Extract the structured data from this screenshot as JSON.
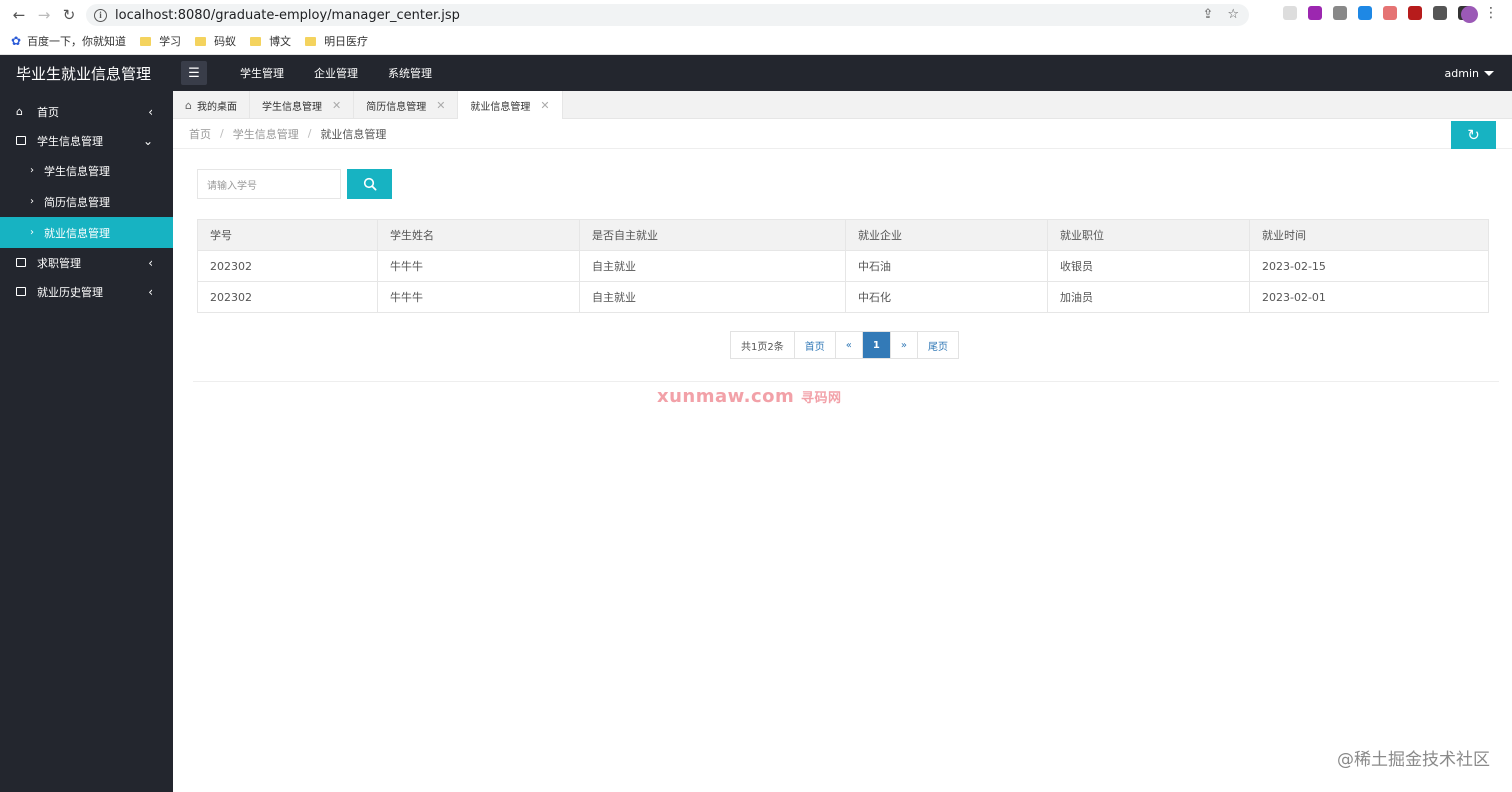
{
  "browser": {
    "url": "localhost:8080/graduate-employ/manager_center.jsp",
    "bookmarks": [
      "百度一下，你就知道",
      "学习",
      "码蚁",
      "博文",
      "明日医疗"
    ]
  },
  "app": {
    "title": "毕业生就业信息管理",
    "topnav": [
      "学生管理",
      "企业管理",
      "系统管理"
    ],
    "user": "admin"
  },
  "sidebar": {
    "home": "首页",
    "student_group": "学生信息管理",
    "sub_items": [
      "学生信息管理",
      "简历信息管理",
      "就业信息管理"
    ],
    "job_manage": "求职管理",
    "history_manage": "就业历史管理"
  },
  "tabs": [
    {
      "label": "我的桌面"
    },
    {
      "label": "学生信息管理"
    },
    {
      "label": "简历信息管理"
    },
    {
      "label": "就业信息管理"
    }
  ],
  "breadcrumb": [
    "首页",
    "学生信息管理",
    "就业信息管理"
  ],
  "search": {
    "placeholder": "请输入学号"
  },
  "table": {
    "headers": [
      "学号",
      "学生姓名",
      "是否自主就业",
      "就业企业",
      "就业职位",
      "就业时间"
    ],
    "rows": [
      [
        "202302",
        "牛牛牛",
        "自主就业",
        "中石油",
        "收银员",
        "2023-02-15"
      ],
      [
        "202302",
        "牛牛牛",
        "自主就业",
        "中石化",
        "加油员",
        "2023-02-01"
      ]
    ]
  },
  "pager": {
    "summary": "共1页2条",
    "first": "首页",
    "prev": "«",
    "current": "1",
    "next": "»",
    "last": "尾页"
  },
  "watermark": {
    "text": "xunmaw.com",
    "cn": "寻码网"
  },
  "corner_mark": "@稀土掘金技术社区",
  "colors": {
    "accent": "#17b3c2",
    "dark": "#23262e",
    "pager_active": "#337ab7"
  }
}
